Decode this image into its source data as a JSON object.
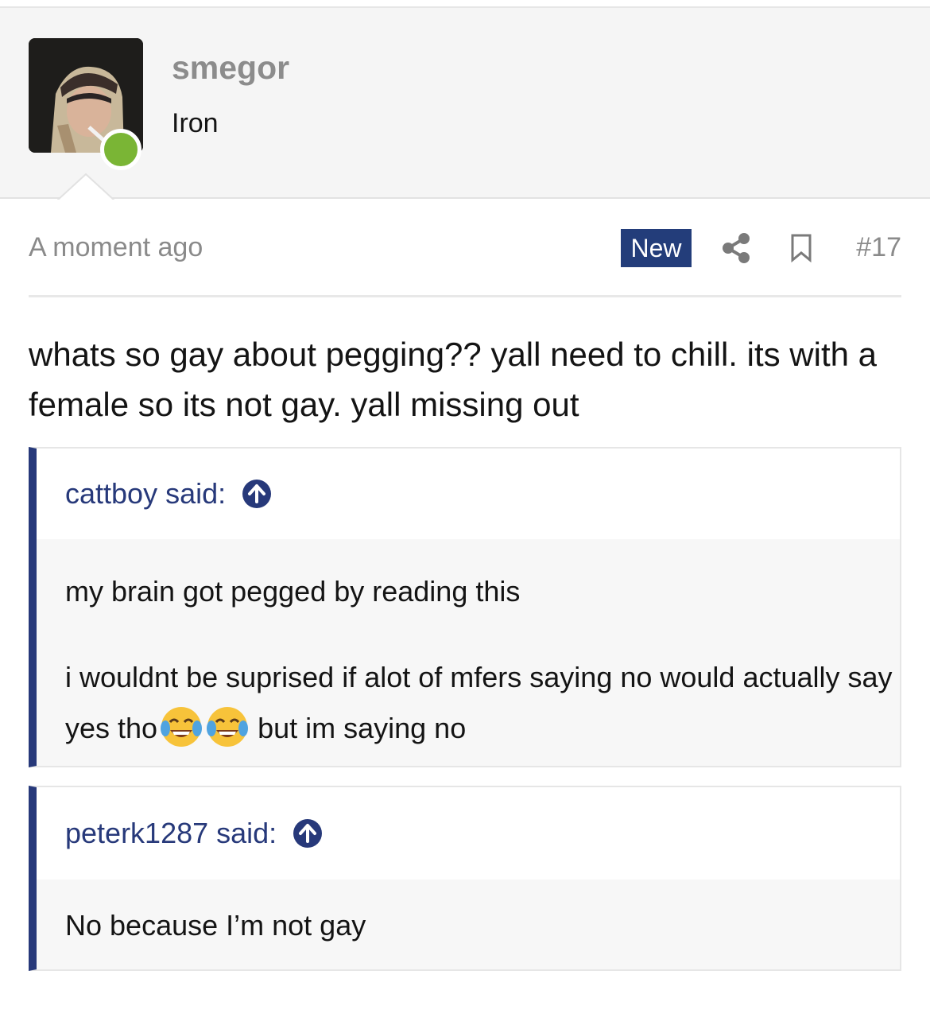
{
  "user": {
    "name": "smegor",
    "title": "Iron",
    "status_color": "#7ab535"
  },
  "post": {
    "time": "A moment ago",
    "badge": "New",
    "number": "#17",
    "body": "whats so gay about pegging?? yall need to chill. its with a female so its not gay. yall missing out",
    "icons": [
      "share-icon",
      "bookmark-icon"
    ]
  },
  "quotes": [
    {
      "author": "cattboy said:",
      "line1": "my brain got pegged by reading this",
      "line2_start": "i wouldnt be suprised if alot of mfers saying no would actually say yes tho",
      "line2_end": " but im saying no",
      "emoji": "face-with-tears-of-joy",
      "emoji_count": 2
    },
    {
      "author": "peterk1287 said:",
      "text": "No because I’m not gay"
    }
  ],
  "colors": {
    "accent": "#27397a",
    "badge": "#233d7a",
    "muted": "#8a8a8a"
  }
}
